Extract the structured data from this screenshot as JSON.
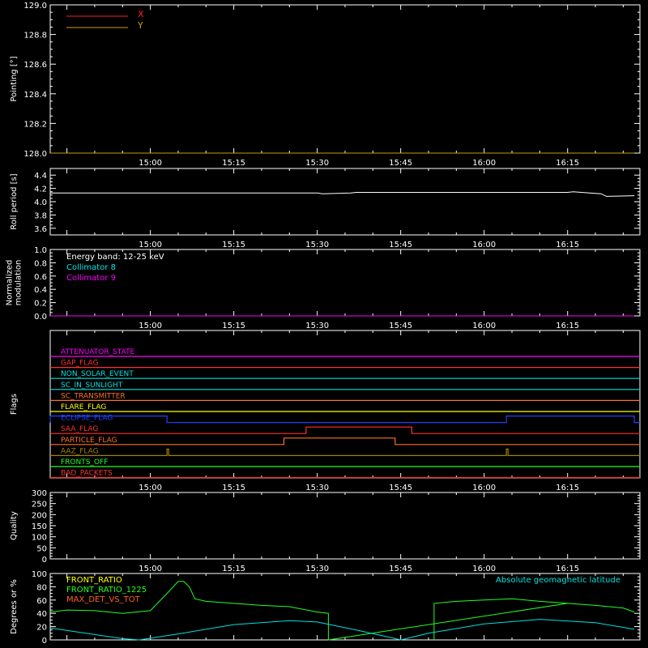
{
  "colors": {
    "background": "#000000",
    "axis": "#ffffff",
    "x_series": "#ff2020",
    "y_series": "#c8a000",
    "modulation_line": "#ff00ff",
    "collimator8": "#00e8e8",
    "collimator9": "#ff00ff",
    "front_ratio": "#ffff00",
    "front_ratio_1225": "#22ff22",
    "max_det_vs_tot": "#ff6020",
    "geomag": "#00e0e0"
  },
  "time_ticks": [
    "15:00",
    "15:15",
    "15:30",
    "15:45",
    "16:00",
    "16:15"
  ],
  "time_range_minutes": [
    882,
    988
  ],
  "chart_data": [
    {
      "id": "pointing",
      "type": "line",
      "ylabel": "Pointing [°]",
      "ylim": [
        128.0,
        129.0
      ],
      "yticks": [
        "128.0",
        "128.2",
        "128.4",
        "128.6",
        "128.8",
        "129.0"
      ],
      "legend_placement": "top-left",
      "series": [
        {
          "name": "X",
          "color": "#ff2020",
          "x": [
            "14:42",
            "16:27"
          ],
          "y": [
            128.0,
            128.0
          ]
        },
        {
          "name": "Y",
          "color": "#c8a000",
          "x": [
            "14:42",
            "16:27"
          ],
          "y": [
            128.0,
            128.0
          ]
        }
      ]
    },
    {
      "id": "roll",
      "type": "line",
      "ylabel": "Roll period [s]",
      "ylim": [
        3.5,
        4.5
      ],
      "yticks": [
        "3.6",
        "3.8",
        "4.0",
        "4.2",
        "4.4"
      ],
      "series": [
        {
          "x": [
            "14:42",
            "15:30",
            "15:31",
            "15:36",
            "15:37",
            "16:15",
            "16:16",
            "16:21",
            "16:22",
            "16:27"
          ],
          "y": [
            4.13,
            4.13,
            4.12,
            4.13,
            4.14,
            4.14,
            4.15,
            4.12,
            4.08,
            4.09
          ]
        }
      ]
    },
    {
      "id": "modulation",
      "type": "line",
      "ylabel": "Normalized modulation",
      "ylim": [
        0.0,
        1.0
      ],
      "yticks": [
        "0.0",
        "0.2",
        "0.4",
        "0.6",
        "0.8",
        "1.0"
      ],
      "annotation": "Energy band: 12-25 keV",
      "series": [
        {
          "name": "Collimator 8",
          "color": "#00e8e8"
        },
        {
          "name": "Collimator 9",
          "color": "#ff00ff",
          "x": [
            "14:42",
            "16:27"
          ],
          "y": [
            0.0,
            0.0
          ]
        }
      ]
    },
    {
      "id": "flags",
      "type": "line",
      "ylabel": "Flags",
      "flags": [
        {
          "name": "ATTENUATOR_STATE",
          "color": "#ff00ff",
          "segments": []
        },
        {
          "name": "GAP_FLAG",
          "color": "#ff3030",
          "segments": []
        },
        {
          "name": "NON_SOLAR_EVENT",
          "color": "#00e0e0",
          "segments": []
        },
        {
          "name": "SC_IN_SUNLIGHT",
          "color": "#00e0e0",
          "segments": []
        },
        {
          "name": "SC_TRANSMITTER",
          "color": "#ff7020",
          "segments": []
        },
        {
          "name": "FLARE_FLAG",
          "color": "#ffff00",
          "segments": []
        },
        {
          "name": "ECLIPSE_FLAG",
          "color": "#2040ff",
          "segments": [
            [
              "14:42",
              "15:03"
            ],
            [
              "16:04",
              "16:27"
            ]
          ]
        },
        {
          "name": "SAA_FLAG",
          "color": "#ff3030",
          "segments": [
            [
              "15:28",
              "15:47"
            ]
          ]
        },
        {
          "name": "PARTICLE_FLAG",
          "color": "#ff7020",
          "segments": [
            [
              "15:24",
              "15:44"
            ]
          ]
        },
        {
          "name": "AAZ_FLAG",
          "color": "#a08000",
          "segments": [
            [
              "15:03",
              "15:03"
            ],
            [
              "16:04",
              "16:04"
            ]
          ]
        },
        {
          "name": "FRONTS_OFF",
          "color": "#22ff22",
          "segments": []
        },
        {
          "name": "BAD_PACKETS",
          "color": "#ff3030",
          "segments": []
        }
      ]
    },
    {
      "id": "quality",
      "type": "line",
      "ylabel": "Quality",
      "ylim": [
        0,
        300
      ],
      "yticks": [
        "0",
        "50",
        "100",
        "150",
        "200",
        "250",
        "300"
      ],
      "series": []
    },
    {
      "id": "ratios",
      "type": "line",
      "ylabel": "Degrees or %",
      "ylim": [
        0,
        100
      ],
      "yticks": [
        "0",
        "20",
        "40",
        "60",
        "80",
        "100"
      ],
      "legend": [
        "FRONT_RATIO",
        "FRONT_RATIO_1225",
        "MAX_DET_VS_TOT"
      ],
      "annotation": "Absolute geomagnetic latitude",
      "series": [
        {
          "name": "FRONT_RATIO_1225",
          "color": "#22ff22",
          "x": [
            "14:42",
            "14:45",
            "14:50",
            "14:55",
            "15:00",
            "15:03",
            "15:05",
            "15:06",
            "15:07",
            "15:08",
            "15:10",
            "15:15",
            "15:20",
            "15:25",
            "15:30",
            "15:32",
            "15:32",
            "16:15",
            "16:20",
            "16:25",
            "16:27"
          ],
          "y": [
            42,
            45,
            44,
            40,
            44,
            70,
            88,
            88,
            80,
            62,
            58,
            55,
            52,
            50,
            42,
            40,
            0,
            55,
            52,
            48,
            42
          ]
        },
        {
          "name": "FRONT_RATIO_1225",
          "color": "#22ff22",
          "x": [
            "15:51",
            "15:51",
            "15:55",
            "16:00",
            "16:05",
            "16:10",
            "16:15"
          ],
          "y": [
            0,
            55,
            58,
            60,
            62,
            58,
            55
          ]
        },
        {
          "name": "Absolute geomagnetic latitude",
          "color": "#00e0e0",
          "x": [
            "14:42",
            "14:50",
            "14:55",
            "14:58",
            "15:05",
            "15:15",
            "15:25",
            "15:30",
            "15:37",
            "15:43",
            "15:45",
            "15:50",
            "16:00",
            "16:10",
            "16:20",
            "16:27"
          ],
          "y": [
            18,
            8,
            2,
            0,
            9,
            23,
            29,
            27,
            15,
            4,
            0,
            10,
            24,
            31,
            26,
            16
          ]
        }
      ]
    }
  ]
}
